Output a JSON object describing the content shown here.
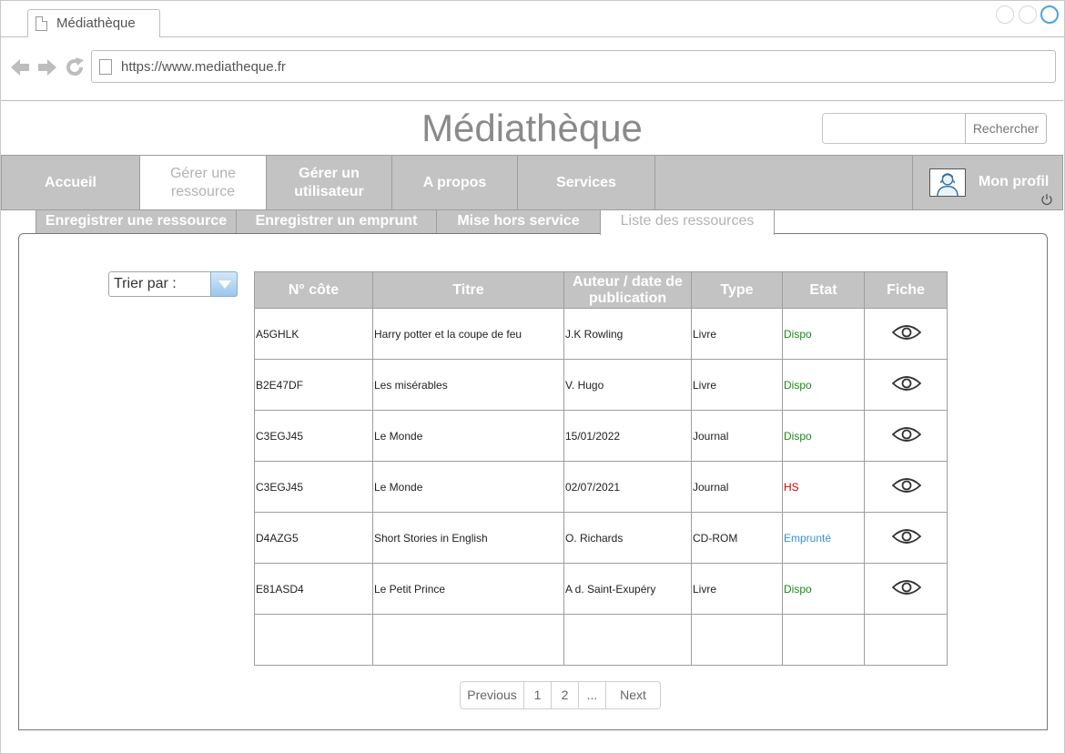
{
  "browser": {
    "tab_title": "Médiathèque",
    "url": "https://www.mediatheque.fr"
  },
  "site": {
    "title": "Médiathèque",
    "search_button": "Rechercher",
    "search_placeholder": ""
  },
  "nav": {
    "items": [
      {
        "label": "Accueil"
      },
      {
        "label": "Gérer une ressource"
      },
      {
        "label": "Gérer un utilisateur"
      },
      {
        "label": "A propos"
      },
      {
        "label": "Services"
      }
    ],
    "active": "Gérer une ressource",
    "profile_label": "Mon profil"
  },
  "subtabs": [
    {
      "label": "Enregistrer une ressource"
    },
    {
      "label": "Enregistrer un emprunt"
    },
    {
      "label": "Mise hors service"
    },
    {
      "label": "Liste des ressources"
    }
  ],
  "sort": {
    "label": "Trier par :"
  },
  "table": {
    "headers": [
      "N° côte",
      "Titre",
      "Auteur / date de publication",
      "Type",
      "Etat",
      "Fiche"
    ],
    "rows": [
      {
        "cote": "A5GHLK",
        "titre": "Harry potter et la coupe de feu",
        "auteur": "J.K Rowling",
        "type": "Livre",
        "etat": "Dispo",
        "etat_status": "dispo"
      },
      {
        "cote": "B2E47DF",
        "titre": "Les misérables",
        "auteur": "V. Hugo",
        "type": "Livre",
        "etat": "Dispo",
        "etat_status": "dispo"
      },
      {
        "cote": "C3EGJ45",
        "titre": "Le Monde",
        "auteur": "15/01/2022",
        "type": "Journal",
        "etat": "Dispo",
        "etat_status": "dispo"
      },
      {
        "cote": "C3EGJ45",
        "titre": "Le Monde",
        "auteur": "02/07/2021",
        "type": "Journal",
        "etat": "HS",
        "etat_status": "hs"
      },
      {
        "cote": "D4AZG5",
        "titre": "Short Stories in English",
        "auteur": "O. Richards",
        "type": "CD-ROM",
        "etat": "Emprunté",
        "etat_status": "emprunte"
      },
      {
        "cote": "E81ASD4",
        "titre": "Le Petit Prince",
        "auteur": "A d. Saint-Exupéry",
        "type": "Livre",
        "etat": "Dispo",
        "etat_status": "dispo"
      }
    ]
  },
  "pagination": {
    "previous": "Previous",
    "pages": [
      "1",
      "2",
      "..."
    ],
    "next": "Next"
  },
  "colors": {
    "nav_bg": "#c3c3c3",
    "dispo": "#1a8a1a",
    "hs": "#d60000",
    "emprunte": "#3b8fd6"
  }
}
